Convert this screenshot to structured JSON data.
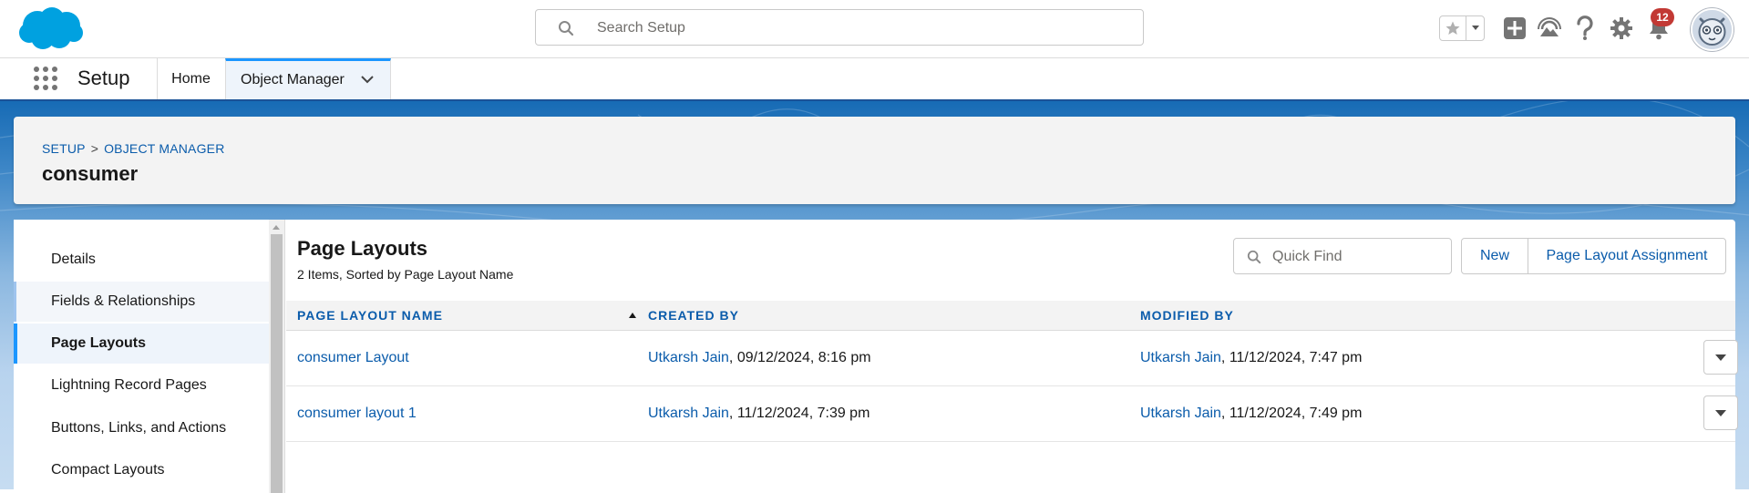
{
  "global_header": {
    "search_placeholder": "Search Setup",
    "notification_count": "12"
  },
  "context_bar": {
    "app_name": "Setup",
    "tabs": [
      {
        "label": "Home"
      },
      {
        "label": "Object Manager"
      }
    ]
  },
  "object_header": {
    "breadcrumb": [
      "SETUP",
      "OBJECT MANAGER"
    ],
    "breadcrumb_separator": ">",
    "title": "consumer"
  },
  "sidebar": {
    "items": [
      {
        "label": "Details"
      },
      {
        "label": "Fields & Relationships"
      },
      {
        "label": "Page Layouts"
      },
      {
        "label": "Lightning Record Pages"
      },
      {
        "label": "Buttons, Links, and Actions"
      },
      {
        "label": "Compact Layouts"
      }
    ],
    "active_item": "Page Layouts"
  },
  "content": {
    "title": "Page Layouts",
    "subtitle": "2 Items, Sorted by Page Layout Name",
    "quick_find_placeholder": "Quick Find",
    "buttons": {
      "new": "New",
      "assignment": "Page Layout Assignment"
    },
    "columns": [
      "PAGE LAYOUT NAME",
      "CREATED BY",
      "MODIFIED BY"
    ],
    "rows": [
      {
        "name": "consumer Layout",
        "created_by": "Utkarsh Jain",
        "created_at": ", 09/12/2024, 8:16 pm",
        "modified_by": "Utkarsh Jain",
        "modified_at": ", 11/12/2024, 7:47 pm"
      },
      {
        "name": "consumer layout 1",
        "created_by": "Utkarsh Jain",
        "created_at": ", 11/12/2024, 7:39 pm",
        "modified_by": "Utkarsh Jain",
        "modified_at": ", 11/12/2024, 7:49 pm"
      }
    ]
  },
  "colors": {
    "brand": "#00a1e0",
    "link": "#0b5cab",
    "active_border": "#1b96ff",
    "notification": "#c23934"
  },
  "icons": [
    "salesforce-logo",
    "search-icon",
    "star-icon",
    "chevron-down-icon",
    "add-icon",
    "trailhead-icon",
    "help-icon",
    "gear-icon",
    "bell-icon",
    "avatar",
    "app-launcher-icon",
    "sort-asc-icon",
    "row-actions-icon"
  ]
}
